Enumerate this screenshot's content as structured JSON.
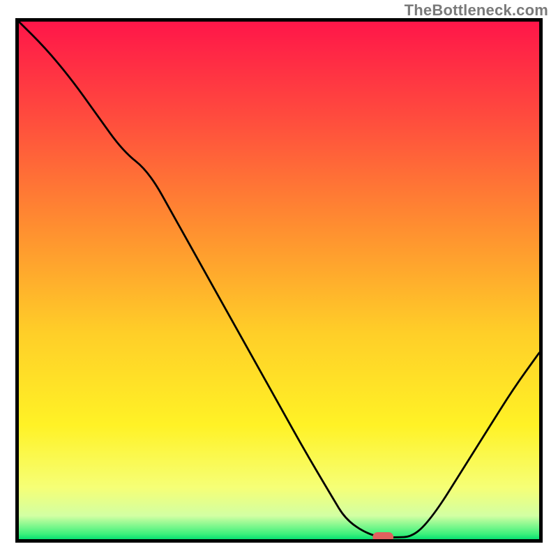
{
  "watermark": "TheBottleneck.com",
  "chart_data": {
    "type": "line",
    "title": "",
    "xlabel": "",
    "ylabel": "",
    "xlim": [
      0,
      100
    ],
    "ylim": [
      0,
      100
    ],
    "grid": false,
    "legend": false,
    "x": [
      0,
      5,
      10,
      15,
      20,
      25,
      30,
      35,
      40,
      45,
      50,
      55,
      60,
      63,
      68,
      72,
      76,
      80,
      85,
      90,
      95,
      100
    ],
    "values": [
      100,
      95,
      89,
      82,
      75,
      71,
      62,
      53,
      44,
      35,
      26,
      17,
      8.5,
      3.5,
      0.5,
      0.3,
      0.5,
      5,
      13,
      21,
      29,
      36
    ],
    "series": [
      {
        "name": "bottleneck-curve",
        "x": [
          0,
          5,
          10,
          15,
          20,
          25,
          30,
          35,
          40,
          45,
          50,
          55,
          60,
          63,
          68,
          72,
          76,
          80,
          85,
          90,
          95,
          100
        ],
        "values": [
          100,
          95,
          89,
          82,
          75,
          71,
          62,
          53,
          44,
          35,
          26,
          17,
          8.5,
          3.5,
          0.5,
          0.3,
          0.5,
          5,
          13,
          21,
          29,
          36
        ]
      }
    ],
    "annotations": [
      {
        "type": "capsule",
        "x": 70,
        "y": 0.4,
        "length_pct": 4,
        "color": "#e0615e"
      }
    ],
    "background_gradient": {
      "direction": "vertical",
      "stops": [
        {
          "offset": 0.0,
          "color": "#ff1649"
        },
        {
          "offset": 0.18,
          "color": "#ff4a3e"
        },
        {
          "offset": 0.4,
          "color": "#ff8f30"
        },
        {
          "offset": 0.6,
          "color": "#ffce28"
        },
        {
          "offset": 0.78,
          "color": "#fff226"
        },
        {
          "offset": 0.9,
          "color": "#f6ff76"
        },
        {
          "offset": 0.955,
          "color": "#d2ffa3"
        },
        {
          "offset": 0.99,
          "color": "#3df17c"
        },
        {
          "offset": 1.0,
          "color": "#07e072"
        }
      ]
    }
  }
}
